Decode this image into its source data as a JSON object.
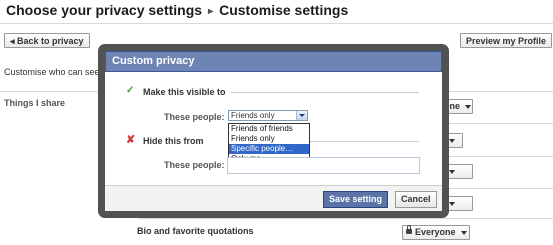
{
  "header": {
    "title": "Choose your privacy settings",
    "separator": "▸",
    "subtitle": "Customise settings"
  },
  "toolbar": {
    "back_label": "◂ Back to privacy",
    "preview_label": "Preview my Profile"
  },
  "background": {
    "intro_text": "Customise who can see",
    "section_label": "Things I share",
    "bio_label": "Bio and favorite quotations",
    "row_dropdowns": [
      "one",
      "",
      "",
      ""
    ],
    "everyone_label": "Everyone"
  },
  "dialog": {
    "title": "Custom privacy",
    "visible_section": "Make this visible to",
    "hide_section": "Hide this from",
    "these_people_label": "These people:",
    "select_value": "Friends only",
    "options": [
      "Friends of friends",
      "Friends only",
      "Specific people…",
      "Only me"
    ],
    "selected_option_index": 2,
    "hide_input_value": "",
    "save_label": "Save setting",
    "cancel_label": "Cancel"
  },
  "colors": {
    "dialog_header": "#6d84b4",
    "primary_button": "#5b74a8",
    "overlay": "#525252",
    "option_highlight": "#3167c8"
  }
}
